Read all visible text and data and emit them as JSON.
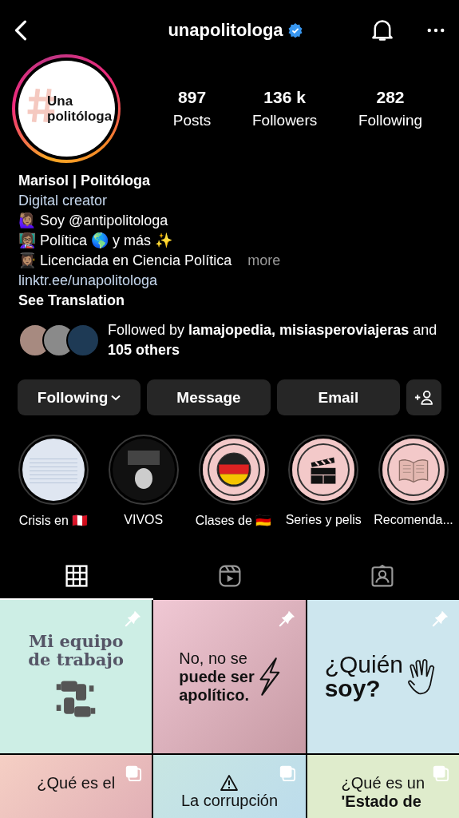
{
  "header": {
    "username": "unapolitologa",
    "verified": true
  },
  "avatar": {
    "logo_lines": [
      "Una",
      "politóloga"
    ],
    "story_ring": true
  },
  "stats": [
    {
      "value": "897",
      "label": "Posts"
    },
    {
      "value": "136 k",
      "label": "Followers"
    },
    {
      "value": "282",
      "label": "Following"
    }
  ],
  "name": "Marisol | Politóloga",
  "category": "Digital creator",
  "bio_lines": [
    "🙋🏽‍♀️ Soy @antipolitologa",
    "👩🏽‍🏫 Política 🌎 y más ✨",
    "👩🏽‍🎓 Licenciada en Ciencia Política"
  ],
  "more": "more",
  "link": "linktr.ee/unapolitologa",
  "see_translation": "See Translation",
  "followed_by": "Followed by **lamajopedia, misiasperoviajeras** and **105 others**",
  "buttons": [
    {
      "kind": "dropdown",
      "label": "Following"
    },
    {
      "kind": "plain",
      "label": "Message"
    },
    {
      "kind": "plain",
      "label": "Email"
    },
    {
      "kind": "add-person"
    }
  ],
  "highlights": [
    {
      "kind": "photo",
      "label": "Crisis en 🇵🇪"
    },
    {
      "kind": "live",
      "label": "VIVOS"
    },
    {
      "kind": "flag",
      "label": "Clases de 🇩🇪"
    },
    {
      "kind": "clapper",
      "label": "Series y pelis"
    },
    {
      "kind": "book",
      "label": "Recomenda..."
    }
  ],
  "tabs": [
    {
      "kind": "grid",
      "selected": true
    },
    {
      "kind": "reels",
      "selected": false
    },
    {
      "kind": "tagged",
      "selected": false
    }
  ],
  "posts": [
    {
      "kind": "team",
      "pinned": true,
      "carousel": false,
      "lines": [
        "Mi equipo",
        "de trabajo"
      ]
    },
    {
      "kind": "bolt",
      "pinned": true,
      "carousel": false,
      "lines": [
        "No, no se",
        "**puede ser**",
        "**apolítico.**"
      ]
    },
    {
      "kind": "wave",
      "pinned": true,
      "carousel": false,
      "lines": [
        "¿Quién",
        "**soy?**"
      ]
    },
    {
      "kind": "text",
      "pinned": false,
      "carousel": true,
      "lines": [
        "¿Qué es el"
      ]
    },
    {
      "kind": "warning",
      "pinned": false,
      "carousel": true,
      "lines": [
        "La corrupción"
      ]
    },
    {
      "kind": "text",
      "pinned": false,
      "carousel": true,
      "lines": [
        "¿Qué es un",
        "**'Estado de**"
      ]
    }
  ]
}
